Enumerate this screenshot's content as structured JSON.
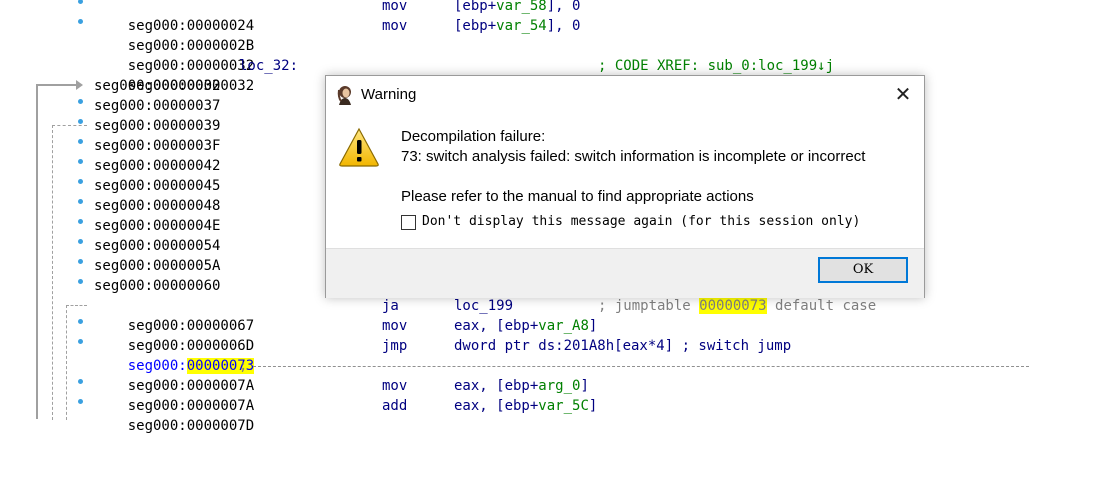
{
  "colors": {
    "address": "#000000",
    "current_address": "#0000ff",
    "code": "#000080",
    "comment": "#008000",
    "highlight": "#ffff00",
    "accent": "#0078d7"
  },
  "listing": [
    {
      "addr": "seg000:00000024",
      "mnem": "mov",
      "ops_pre": "[ebp+",
      "ops_var": "var_58",
      "ops_post": "], 0"
    },
    {
      "addr": "seg000:0000002B",
      "mnem": "mov",
      "ops_pre": "[ebp+",
      "ops_var": "var_54",
      "ops_post": "], 0"
    },
    {
      "addr": "seg000:00000032"
    },
    {
      "addr": "seg000:00000032",
      "label": "loc_32:",
      "comment": "; CODE XREF: sub_0:loc_199↓j"
    },
    {
      "addr": "seg000:00000032"
    },
    {
      "addr": "seg000:00000037"
    },
    {
      "addr": "seg000:00000039"
    },
    {
      "addr": "seg000:0000003F"
    },
    {
      "addr": "seg000:00000042"
    },
    {
      "addr": "seg000:00000045"
    },
    {
      "addr": "seg000:00000048"
    },
    {
      "addr": "seg000:0000004E"
    },
    {
      "addr": "seg000:00000054"
    },
    {
      "addr": "seg000:0000005A"
    },
    {
      "addr": "seg000:00000060"
    },
    {
      "addr": "seg000:00000067",
      "mnem": "ja",
      "ops": "loc_199",
      "cmt_pre": "; jumptable ",
      "cmt_hl": "00000073",
      "cmt_post": " default case"
    },
    {
      "addr": "seg000:0000006D",
      "mnem": "mov",
      "ops_pre": "eax, [ebp+",
      "ops_var": "var_A8",
      "ops_post": "]"
    },
    {
      "addr_pre": "seg000:",
      "addr_hl": "00000073",
      "mnem": "jmp",
      "ops": "dword ptr ds:201A8h[eax*4] ; switch jump"
    },
    {
      "addr": "seg000:0000007A",
      "separator": ";"
    },
    {
      "addr": "seg000:0000007A",
      "mnem": "mov",
      "ops_pre": "eax, [ebp+",
      "ops_var": "arg_0",
      "ops_post": "]"
    },
    {
      "addr": "seg000:0000007D",
      "mnem": "add",
      "ops_pre": "eax, [ebp+",
      "ops_var": "var_5C",
      "ops_post": "]"
    }
  ],
  "dialog": {
    "title": "Warning",
    "close_icon": "close-icon",
    "message_line1": "Decompilation failure:",
    "message_line2": "73: switch analysis failed: switch information is incomplete or incorrect",
    "message_line3": "Please refer to the manual to find appropriate actions",
    "checkbox_label": "Don't display this message again (for this session only)",
    "checkbox_checked": false,
    "ok_label": "OK"
  }
}
